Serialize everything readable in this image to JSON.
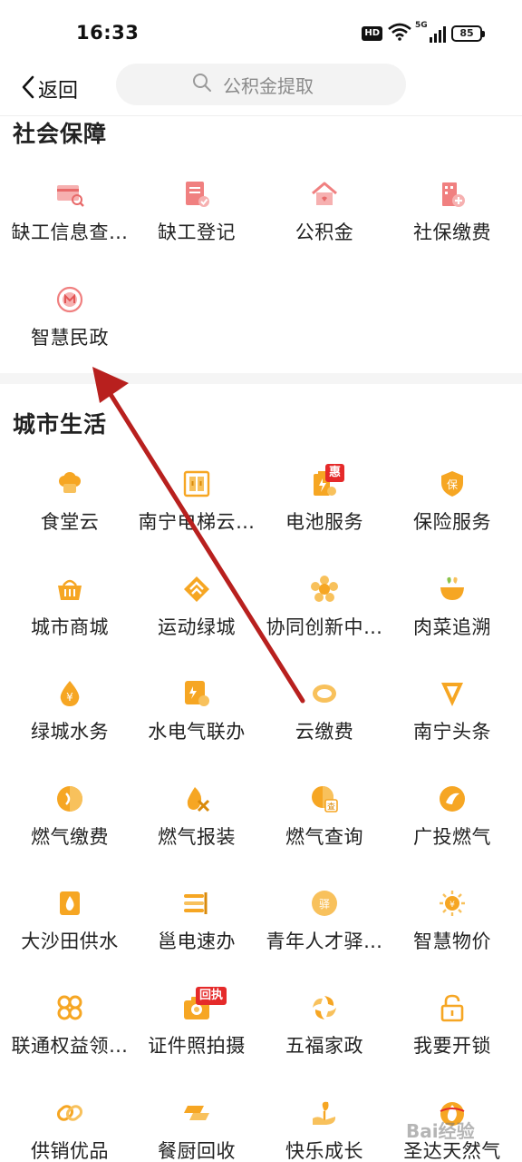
{
  "status_bar": {
    "time": "16:33",
    "hd_badge": "HD",
    "network": "5G",
    "battery": "85"
  },
  "nav": {
    "back_label": "返回",
    "search_placeholder": "公积金提取"
  },
  "sections": [
    {
      "title": "社会保障",
      "items": [
        {
          "label": "缺工信息查…",
          "icon": "card-search-icon"
        },
        {
          "label": "缺工登记",
          "icon": "document-check-icon"
        },
        {
          "label": "公积金",
          "icon": "house-icon"
        },
        {
          "label": "社保缴费",
          "icon": "building-plus-icon"
        },
        {
          "label": "智慧民政",
          "icon": "civil-affairs-emblem-icon"
        }
      ]
    },
    {
      "title": "城市生活",
      "items": [
        {
          "label": "食堂云",
          "icon": "chef-hat-icon"
        },
        {
          "label": "南宁电梯云…",
          "icon": "elevator-icon"
        },
        {
          "label": "电池服务",
          "icon": "battery-service-icon",
          "badge": "惠"
        },
        {
          "label": "保险服务",
          "icon": "insurance-shield-icon"
        },
        {
          "label": "城市商城",
          "icon": "shopping-basket-icon"
        },
        {
          "label": "运动绿城",
          "icon": "sport-diamond-icon"
        },
        {
          "label": "协同创新中…",
          "icon": "innovation-flower-icon"
        },
        {
          "label": "肉菜追溯",
          "icon": "food-bowl-icon"
        },
        {
          "label": "绿城水务",
          "icon": "water-drop-yuan-icon"
        },
        {
          "label": "水电气联办",
          "icon": "utility-document-icon"
        },
        {
          "label": "云缴费",
          "icon": "cloud-ring-icon"
        },
        {
          "label": "南宁头条",
          "icon": "headline-v-icon"
        },
        {
          "label": "燃气缴费",
          "icon": "gas-fee-icon"
        },
        {
          "label": "燃气报装",
          "icon": "gas-install-icon"
        },
        {
          "label": "燃气查询",
          "icon": "gas-query-icon"
        },
        {
          "label": "广投燃气",
          "icon": "guangtou-gas-icon"
        },
        {
          "label": "大沙田供水",
          "icon": "water-supply-icon"
        },
        {
          "label": "邕电速办",
          "icon": "electric-fast-icon"
        },
        {
          "label": "青年人才驿…",
          "icon": "youth-talent-icon"
        },
        {
          "label": "智慧物价",
          "icon": "price-sun-icon"
        },
        {
          "label": "联通权益领…",
          "icon": "unicom-knot-icon"
        },
        {
          "label": "证件照拍摄",
          "icon": "id-photo-camera-icon",
          "badge": "回执"
        },
        {
          "label": "五福家政",
          "icon": "housekeeping-swirl-icon"
        },
        {
          "label": "我要开锁",
          "icon": "padlock-icon"
        },
        {
          "label": "供销优品",
          "icon": "cooperative-link-icon"
        },
        {
          "label": "餐厨回收",
          "icon": "kitchen-recycle-icon"
        },
        {
          "label": "快乐成长",
          "icon": "growth-sprout-icon"
        },
        {
          "label": "圣达天然气",
          "icon": "natural-gas-flame-icon"
        }
      ]
    }
  ],
  "watermark": "Bai经验",
  "colors": {
    "social_icon": "#f08080",
    "city_icon": "#f6a623",
    "badge": "#e52a2a",
    "arrow": "#b8201e"
  }
}
